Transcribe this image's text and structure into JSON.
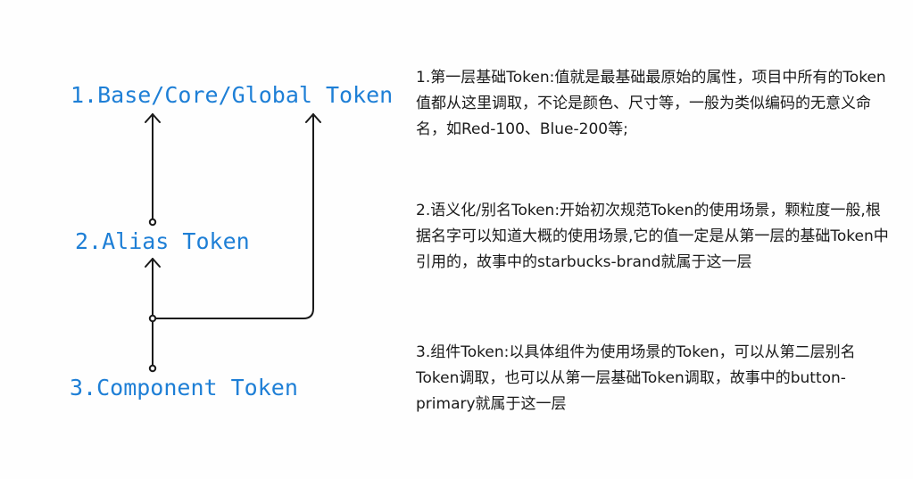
{
  "colors": {
    "label": "#1e7fd6",
    "line": "#1a1a1a",
    "text": "#1a1a1a"
  },
  "levels": [
    {
      "label": "1.Base/Core/Global Token"
    },
    {
      "label": "2.Alias Token"
    },
    {
      "label": "3.Component Token"
    }
  ],
  "descriptions": [
    {
      "text": "1.第一层基础Token:值就是最基础最原始的属性，项目中所有的Token值都从这里调取，不论是颜色、尺寸等，一般为类似编码的无意义命名，如Red-100、Blue-200等;"
    },
    {
      "text": "2.语义化/别名Token:开始初次规范Token的使用场景，颗粒度一般,根据名字可以知道大概的使用场景,它的值一定是从第一层的基础Token中引用的，故事中的starbucks-brand就属于这一层"
    },
    {
      "text": "3.组件Token:以具体组件为使用场景的Token，可以从第二层别名Token调取，也可以从第一层基础Token调取，故事中的button-primary就属于这一层"
    }
  ]
}
